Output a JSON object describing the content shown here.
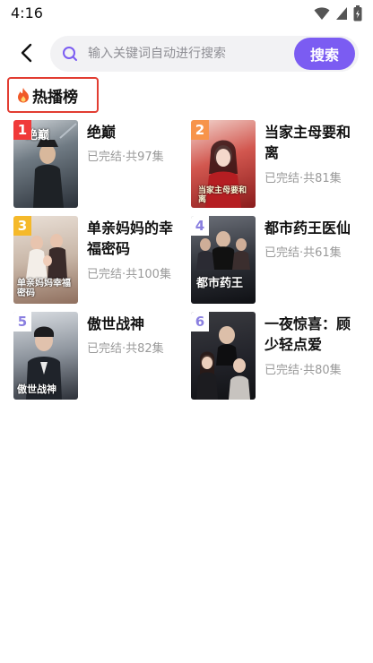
{
  "status_bar": {
    "time": "4:16",
    "icons": [
      "wifi-icon",
      "cellular-signal-icon",
      "battery-icon"
    ]
  },
  "header": {
    "back_icon": "chevron-left-icon",
    "search": {
      "placeholder": "输入关键词自动进行搜索",
      "value": "",
      "icon": "search-icon",
      "button_label": "搜索"
    }
  },
  "section": {
    "title": "热播榜",
    "icon": "fire-icon"
  },
  "colors": {
    "accent": "#7b5cf2",
    "highlight_border": "#e23d32",
    "fire": "#f05a28",
    "rank_1": "#f03a3a",
    "rank_2": "#f7944a",
    "rank_3": "#f5b92a",
    "rank_other_bg": "#ffffff",
    "rank_other_fg": "#8a7fe0"
  },
  "dramas": [
    {
      "rank": "1",
      "title": "绝巅",
      "meta": "已完结·共97集",
      "poster_text": "绝巅"
    },
    {
      "rank": "2",
      "title": "当家主母要和离",
      "meta": "已完结·共81集",
      "poster_text": "当家主母要和离"
    },
    {
      "rank": "3",
      "title": "单亲妈妈的幸福密码",
      "meta": "已完结·共100集",
      "poster_text": "单亲妈妈幸福密码"
    },
    {
      "rank": "4",
      "title": "都市药王医仙",
      "meta": "已完结·共61集",
      "poster_text": "都市药王"
    },
    {
      "rank": "5",
      "title": "傲世战神",
      "meta": "已完结·共82集",
      "poster_text": "傲世战神"
    },
    {
      "rank": "6",
      "title": "一夜惊喜：顾少轻点爱",
      "meta": "已完结·共80集",
      "poster_text": ""
    }
  ]
}
